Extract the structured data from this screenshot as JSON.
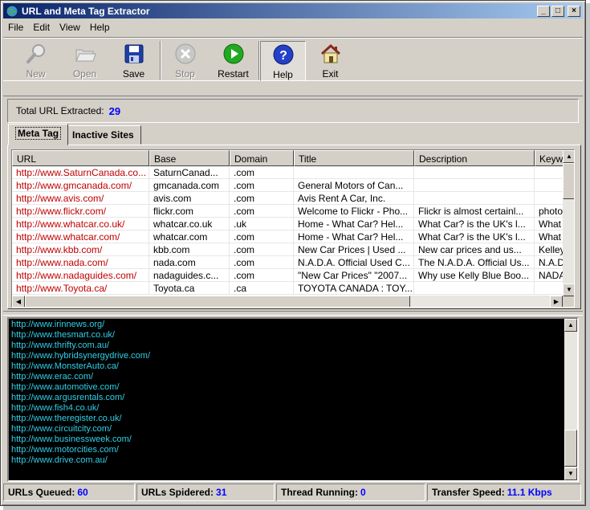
{
  "window": {
    "title": "URL and Meta Tag Extractor"
  },
  "menu": [
    "File",
    "Edit",
    "View",
    "Help"
  ],
  "toolbar": {
    "new": "New",
    "open": "Open",
    "save": "Save",
    "stop": "Stop",
    "restart": "Restart",
    "help": "Help",
    "exit": "Exit"
  },
  "total": {
    "label": "Total URL Extracted:",
    "value": "29"
  },
  "tabs": {
    "meta": "Meta Tag",
    "inactive": "Inactive Sites"
  },
  "table": {
    "headers": [
      "URL",
      "Base",
      "Domain",
      "Title",
      "Description",
      "Keyw"
    ],
    "rows": [
      [
        "http://www.SaturnCanada.co...",
        "SaturnCanad...",
        ".com",
        "",
        "",
        ""
      ],
      [
        "http://www.gmcanada.com/",
        "gmcanada.com",
        ".com",
        "General Motors of Can...",
        "",
        ""
      ],
      [
        "http://www.avis.com/",
        "avis.com",
        ".com",
        "Avis Rent A Car, Inc.",
        "",
        ""
      ],
      [
        "http://www.flickr.com/",
        "flickr.com",
        ".com",
        "Welcome to Flickr - Pho...",
        "Flickr is almost certainl...",
        "photo"
      ],
      [
        "http://www.whatcar.co.uk/",
        "whatcar.co.uk",
        ".uk",
        "Home - What Car? Hel...",
        "What Car? is the UK's l...",
        "What"
      ],
      [
        "http://www.whatcar.com/",
        "whatcar.com",
        ".com",
        "Home - What Car? Hel...",
        "What Car? is the UK's l...",
        "What"
      ],
      [
        "http://www.kbb.com/",
        "kbb.com",
        ".com",
        "New Car Prices | Used ...",
        "New car prices and us...",
        "Kelley"
      ],
      [
        "http://www.nada.com/",
        "nada.com",
        ".com",
        "N.A.D.A. Official Used C...",
        "The N.A.D.A. Official Us...",
        "N.A.D"
      ],
      [
        "http://www.nadaguides.com/",
        "nadaguides.c...",
        ".com",
        "\"New Car Prices\" \"2007...",
        "Why use Kelly Blue Boo...",
        "NADA"
      ],
      [
        "http://www.Toyota.ca/",
        "Toyota.ca",
        ".ca",
        "TOYOTA CANADA : TOY...",
        "",
        ""
      ]
    ]
  },
  "log": [
    "http://www.irinnews.org/",
    "http://www.thesmart.co.uk/",
    "http://www.thrifty.com.au/",
    "http://www.hybridsynergydrive.com/",
    "http://www.MonsterAuto.ca/",
    "http://www.erac.com/",
    "http://www.automotive.com/",
    "http://www.argusrentals.com/",
    "http://www.fish4.co.uk/",
    "http://www.theregister.co.uk/",
    "http://www.circuitcity.com/",
    "http://www.businessweek.com/",
    "http://www.motorcities.com/",
    "http://www.drive.com.au/"
  ],
  "status": {
    "queued_label": "URLs Queued:",
    "queued": "60",
    "spidered_label": "URLs Spidered:",
    "spidered": "31",
    "threads_label": "Thread Running:",
    "threads": "0",
    "speed_label": "Transfer Speed:",
    "speed": "11.1 Kbps"
  },
  "colors": {
    "log_text": "#30d0e8",
    "value_blue": "#0000ff",
    "url_red": "#c00000",
    "title_bar": "#0a246a"
  },
  "icons": [
    "globe-icon",
    "magnifier-icon",
    "folder-icon",
    "floppy-disk-icon",
    "stop-icon",
    "play-icon",
    "help-icon",
    "house-icon"
  ]
}
